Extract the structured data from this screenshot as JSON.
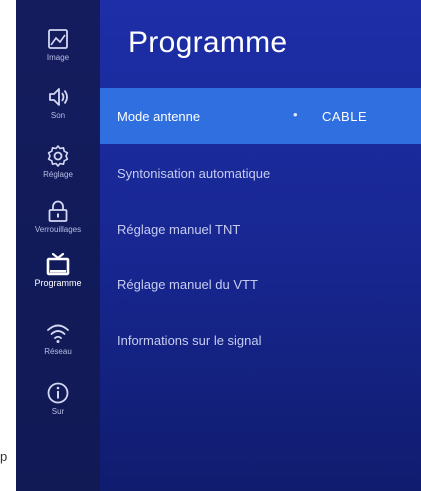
{
  "stray_glyph": "p",
  "sidebar": {
    "items": [
      {
        "label": "Image",
        "icon": "picture-icon"
      },
      {
        "label": "Son",
        "icon": "speaker-icon"
      },
      {
        "label": "Réglage",
        "icon": "gear-icon"
      },
      {
        "label": "Verrouillages",
        "icon": "lock-icon"
      },
      {
        "label": "Programme",
        "icon": "tv-icon",
        "active": true
      },
      {
        "label": "Réseau",
        "icon": "wifi-icon"
      },
      {
        "label": "Sur",
        "icon": "info-icon"
      }
    ]
  },
  "main": {
    "title": "Programme",
    "menu": [
      {
        "label": "Mode antenne",
        "value": "CABLE",
        "selected": true
      },
      {
        "label": "Syntonisation automatique"
      },
      {
        "label": "Réglage manuel TNT"
      },
      {
        "label": "Réglage manuel du VTT"
      },
      {
        "label": "Informations sur le signal"
      }
    ],
    "bullet": "•"
  },
  "colors": {
    "background": "#17268f",
    "sidebar": "#131b5a",
    "selection": "#2f6fe0",
    "text": "#ffffff"
  }
}
